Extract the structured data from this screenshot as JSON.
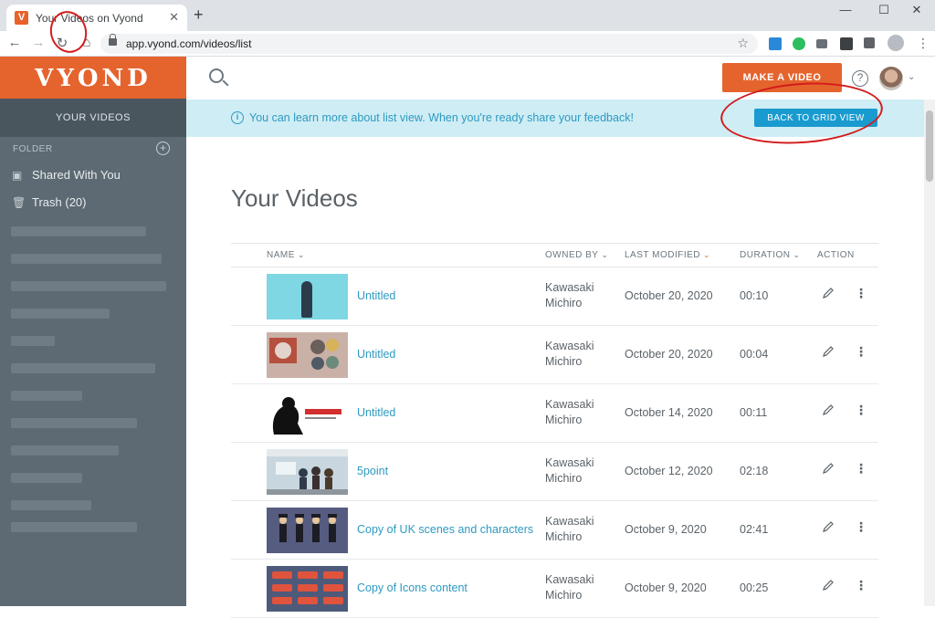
{
  "browser": {
    "tab_title": "Your Videos on Vyond",
    "tab_favicon": "V",
    "close_glyph": "✕",
    "newtab_glyph": "+",
    "url": "app.vyond.com/videos/list",
    "window_min": "—",
    "window_max": "☐",
    "window_close": "✕"
  },
  "sidebar": {
    "logo": "VYOND",
    "active_tab": "YOUR VIDEOS",
    "folder_label": "FOLDER",
    "items": [
      {
        "label": "Shared With You",
        "icon": "shared-folder-icon"
      },
      {
        "label": "Trash (20)",
        "icon": "trash-icon"
      }
    ]
  },
  "header": {
    "make_video": "MAKE A VIDEO",
    "help": "?",
    "caret": "⌄"
  },
  "banner": {
    "message": "You can learn more about list view. When you're ready share your feedback!",
    "button": "BACK TO GRID VIEW",
    "info": "i"
  },
  "main": {
    "title": "Your Videos",
    "columns": {
      "name": "NAME",
      "owned_by": "OWNED BY",
      "last_modified": "LAST MODIFIED",
      "duration": "DURATION",
      "action": "ACTION"
    },
    "rows": [
      {
        "name": "Untitled",
        "owner": "Kawasaki Michiro",
        "modified": "October 20, 2020",
        "duration": "00:10"
      },
      {
        "name": "Untitled",
        "owner": "Kawasaki Michiro",
        "modified": "October 20, 2020",
        "duration": "00:04"
      },
      {
        "name": "Untitled",
        "owner": "Kawasaki Michiro",
        "modified": "October 14, 2020",
        "duration": "00:11"
      },
      {
        "name": "5point",
        "owner": "Kawasaki Michiro",
        "modified": "October 12, 2020",
        "duration": "02:18"
      },
      {
        "name": "Copy of UK scenes and characters",
        "owner": "Kawasaki Michiro",
        "modified": "October 9, 2020",
        "duration": "02:41"
      },
      {
        "name": "Copy of Icons content",
        "owner": "Kawasaki Michiro",
        "modified": "October 9, 2020",
        "duration": "00:25"
      }
    ]
  },
  "colors": {
    "brand": "#e5642e",
    "link": "#2e9ac1",
    "banner_bg": "#cfedf5",
    "sidebar_bg": "#5d6a73",
    "annotation": "#d31c1c"
  }
}
